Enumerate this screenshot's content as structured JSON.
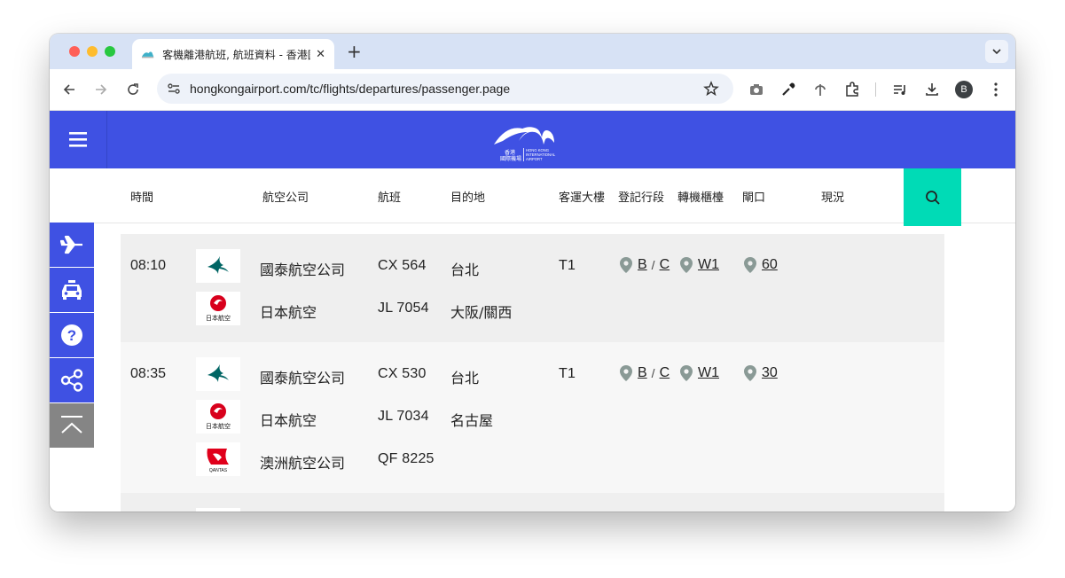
{
  "browser": {
    "tab_title": "客機離港航班, 航班資料 - 香港國際機場",
    "url": "hongkongairport.com/tc/flights/departures/passenger.page",
    "avatar_letter": "B",
    "accent": "#3f51e3"
  },
  "site": {
    "logo_line1": "香港",
    "logo_line2": "國際機場",
    "logo_en1": "HONG KONG",
    "logo_en2": "INTERNATIONAL",
    "logo_en3": "AIRPORT"
  },
  "columns": {
    "time": "時間",
    "airline": "航空公司",
    "flight": "航班",
    "destination": "目的地",
    "terminal": "客運大樓",
    "checkin": "登記行段",
    "transfer": "轉機櫃檯",
    "gate": "閘口",
    "status": "現況"
  },
  "flights": [
    {
      "time": "08:10",
      "terminal": "T1",
      "checkin_a": "B",
      "checkin_b": "C",
      "transfer": "W1",
      "gate": "60",
      "codeshares": [
        {
          "airline": "國泰航空公司",
          "flight": "CX 564",
          "destination": "台北",
          "logo": "cathay-logo"
        },
        {
          "airline": "日本航空",
          "flight": "JL 7054",
          "destination": "大阪/關西",
          "logo": "jal-logo"
        }
      ]
    },
    {
      "time": "08:35",
      "terminal": "T1",
      "checkin_a": "B",
      "checkin_b": "C",
      "transfer": "W1",
      "gate": "30",
      "codeshares": [
        {
          "airline": "國泰航空公司",
          "flight": "CX 530",
          "destination": "台北",
          "logo": "cathay-logo"
        },
        {
          "airline": "日本航空",
          "flight": "JL 7034",
          "destination": "名古屋",
          "logo": "jal-logo"
        },
        {
          "airline": "澳洲航空公司",
          "flight": "QF 8225",
          "destination": "",
          "logo": "qantas-logo"
        }
      ]
    }
  ],
  "logo_text": {
    "jal": "日本航空",
    "qantas": "QANTAS"
  }
}
